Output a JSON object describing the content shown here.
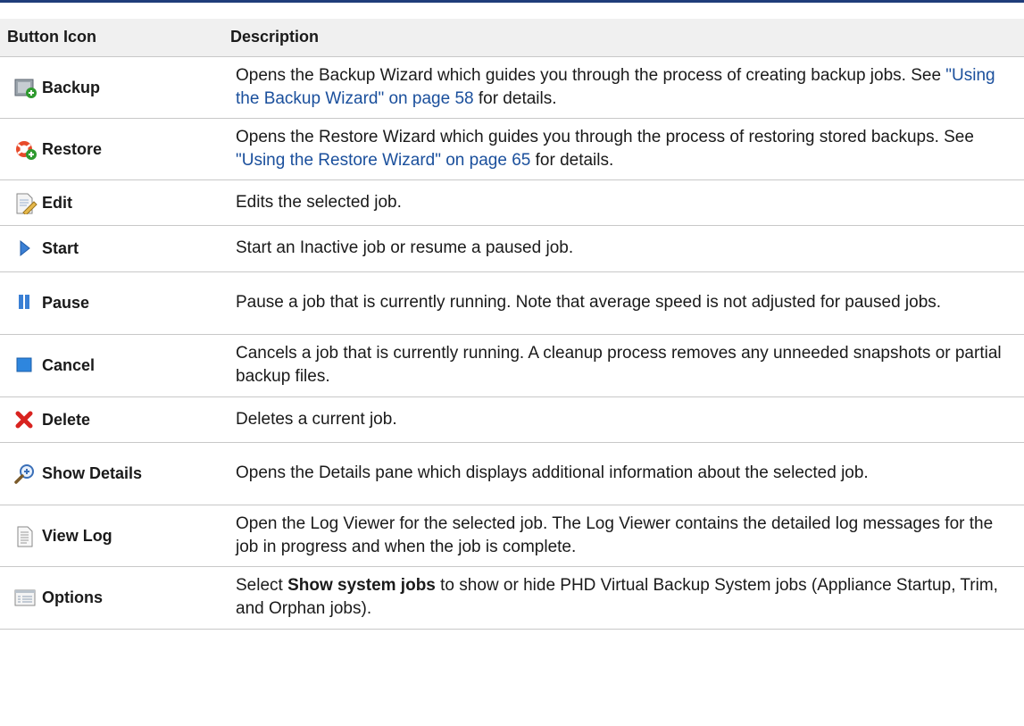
{
  "table": {
    "headers": {
      "button_icon": "Button Icon",
      "description": "Description"
    },
    "rows": [
      {
        "label": "Backup",
        "icon": "backup-icon",
        "desc_1": "Opens the Backup Wizard which guides you through the process of creating backup jobs. See ",
        "link": "\"Using the Backup Wizard\" on page 58",
        "desc_2": " for details."
      },
      {
        "label": "Restore",
        "icon": "restore-icon",
        "desc_1": "Opens the Restore Wizard which guides you through the process of restoring stored backups. See ",
        "link": "\"Using the Restore Wizard\" on page 65",
        "desc_2": " for details."
      },
      {
        "label": "Edit",
        "icon": "edit-icon",
        "desc": "Edits the selected job."
      },
      {
        "label": "Start",
        "icon": "play-icon",
        "desc": "Start an Inactive job or resume a paused job."
      },
      {
        "label": "Pause",
        "icon": "pause-icon",
        "desc": "Pause a job that is currently running. Note that average speed is not adjusted for paused jobs."
      },
      {
        "label": "Cancel",
        "icon": "stop-icon",
        "desc": "Cancels a job that is currently running. A cleanup process removes any unneeded snapshots or partial backup files."
      },
      {
        "label": "Delete",
        "icon": "delete-icon",
        "desc": "Deletes a current job."
      },
      {
        "label": "Show Details",
        "icon": "zoom-in-icon",
        "desc": "Opens the Details pane which displays additional information about the selected job."
      },
      {
        "label": "View Log",
        "icon": "log-icon",
        "desc": "Open the Log Viewer for the selected job. The Log Viewer contains the detailed log messages for the job in progress and when the job is complete."
      },
      {
        "label": "Options",
        "icon": "options-icon",
        "desc_1": "Select ",
        "bold": "Show system jobs",
        "desc_2": " to show or hide PHD Virtual Backup System jobs (Appliance Startup, Trim, and Orphan jobs)."
      }
    ]
  }
}
